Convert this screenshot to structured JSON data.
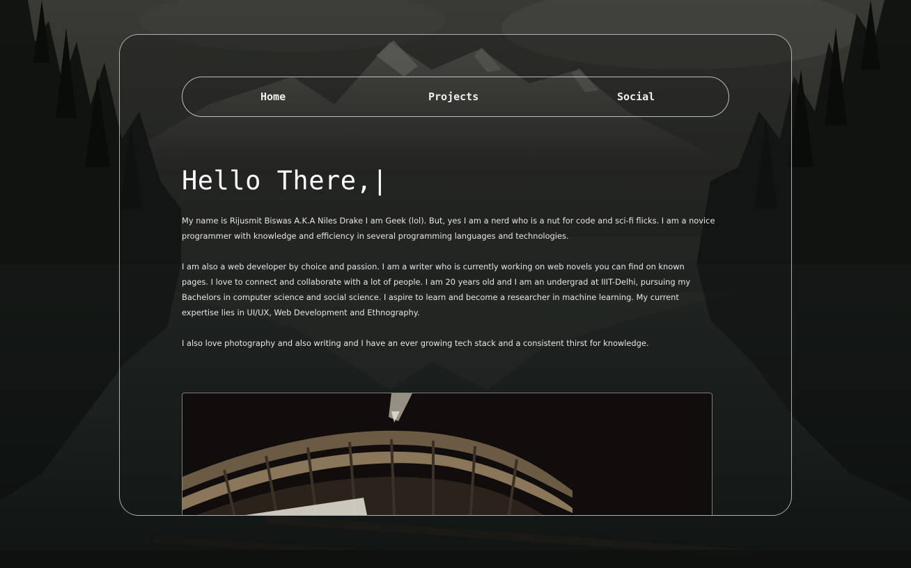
{
  "nav": {
    "home": "Home",
    "projects": "Projects",
    "social": "Social"
  },
  "hero": {
    "title": "Hello There,|"
  },
  "bio": {
    "paragraph_1": "My name is Rijusmit Biswas A.K.A Niles Drake I am Geek (lol). But, yes I am a nerd who is a nut for code and sci-fi flicks. I am a novice programmer with knowledge and efficiency in several programming languages and technologies.",
    "paragraph_2": "I am also a web developer by choice and passion. I am a writer who is currently working on web novels you can find on known pages. I love to connect and collaborate with a lot of people. I am 20 years old and I am an undergrad at IIIT-Delhi, pursuing my Bachelors in computer science and social science. I aspire to learn and become a researcher in machine learning. My current expertise lies in UI/UX, Web Development and Ethnography.",
    "paragraph_3": "I also love photography and also writing and I have an ever growing tech stack and a consistent thirst for knowledge."
  },
  "colors": {
    "text": "#ffffff",
    "card_border": "#dce1e1",
    "background": "#141612"
  }
}
